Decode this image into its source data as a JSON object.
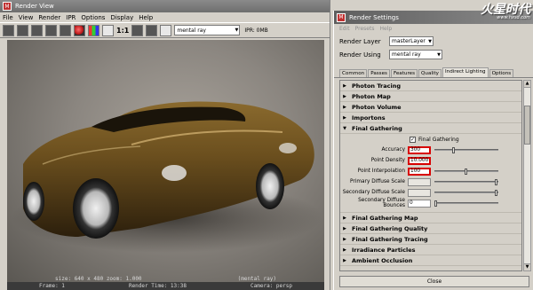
{
  "render_view": {
    "title": "Render View",
    "menu": [
      "File",
      "View",
      "Render",
      "IPR",
      "Options",
      "Display",
      "Help"
    ],
    "ratio_label": "1:1",
    "renderer": "mental ray",
    "ipr_status": "IPR: 0MB",
    "hud_line1": [
      "size: 640 x 480  zoom: 1.000",
      "(mental ray)"
    ],
    "hud_line2": [
      "Frame: 1",
      "Render Time: 13:38",
      "Camera: persp"
    ]
  },
  "render_settings": {
    "title": "Render Settings",
    "menu": [
      "Edit",
      "Presets",
      "Help"
    ],
    "render_layer_label": "Render Layer",
    "render_layer_value": "masterLayer",
    "render_using_label": "Render Using",
    "render_using_value": "mental ray",
    "tabs": [
      "Common",
      "Passes",
      "Features",
      "Quality",
      "Indirect Lighting",
      "Options"
    ],
    "active_tab": "Indirect Lighting",
    "sections_before": [
      "Photon Tracing",
      "Photon Map",
      "Photon Volume",
      "Importons"
    ],
    "open_section": "Final Gathering",
    "fg_checkbox_label": "Final Gathering",
    "attributes": [
      {
        "label": "Accuracy",
        "value": "300",
        "highlight": true,
        "slider": 0.3
      },
      {
        "label": "Point Density",
        "value": "10.000",
        "highlight": true,
        "slider": null
      },
      {
        "label": "Point Interpolation",
        "value": "100",
        "highlight": true,
        "slider": 0.5
      },
      {
        "label": "Primary Diffuse Scale",
        "value": "",
        "highlight": false,
        "slider": 1.0
      },
      {
        "label": "Secondary Diffuse Scale",
        "value": "",
        "highlight": false,
        "slider": 1.0
      },
      {
        "label": "Secondary Diffuse Bounces",
        "value": "0",
        "highlight": false,
        "slider": 0.0
      }
    ],
    "sections_after": [
      "Final Gathering Map",
      "Final Gathering Quality",
      "Final Gathering Tracing",
      "Irradiance Particles",
      "Ambient Occlusion"
    ],
    "close_label": "Close"
  },
  "watermark": {
    "text": "火星时代",
    "url": "www.hxsd.com"
  }
}
